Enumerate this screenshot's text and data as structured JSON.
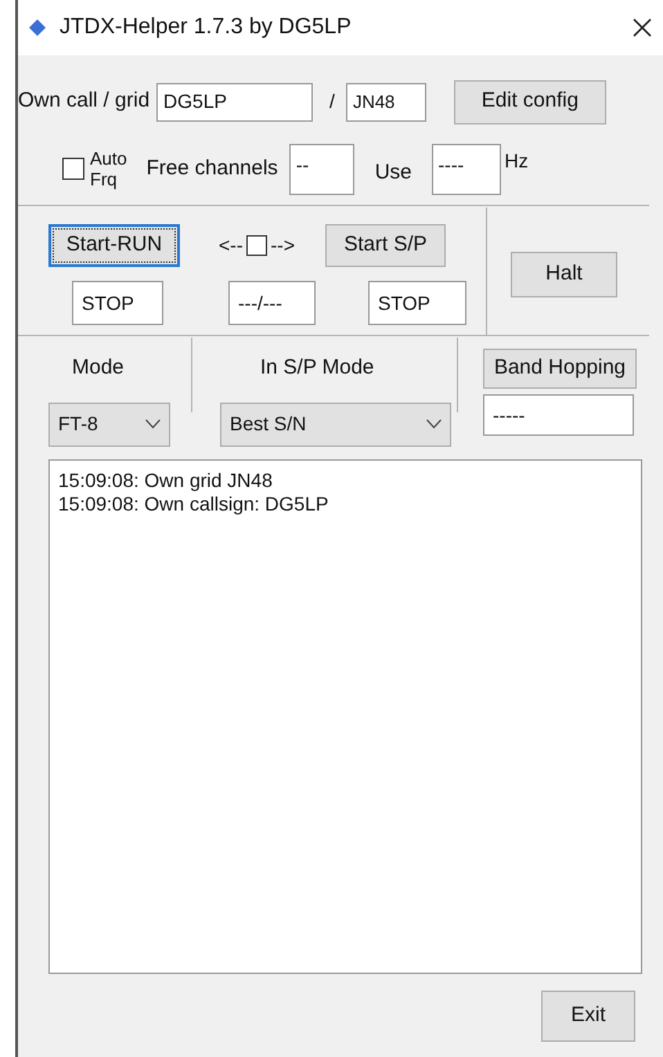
{
  "window": {
    "title": "JTDX-Helper 1.7.3 by DG5LP"
  },
  "own_call": {
    "label": "Own call / grid",
    "call": "DG5LP",
    "separator": "/",
    "grid": "JN48"
  },
  "edit_config_button": "Edit config",
  "auto_frq": {
    "label_lines": [
      "Auto",
      "Frq"
    ],
    "checked": false
  },
  "free_channels": {
    "label": "Free channels",
    "value": "--"
  },
  "use": {
    "label": "Use",
    "value": "----",
    "unit": "Hz"
  },
  "run": {
    "button": "Start-RUN",
    "focused": true,
    "status": "STOP"
  },
  "direction": {
    "left": "<--",
    "right": "-->",
    "checked": false,
    "value": "---/---"
  },
  "sp": {
    "button": "Start S/P",
    "focused": false,
    "status": "STOP"
  },
  "halt_button": "Halt",
  "mode": {
    "label": "Mode",
    "value": "FT-8"
  },
  "sp_mode": {
    "label": "In S/P Mode",
    "value": "Best S/N"
  },
  "band_hopping": {
    "button": "Band Hopping",
    "value": "-----"
  },
  "log": [
    "15:09:08: Own grid JN48",
    "15:09:08: Own callsign: DG5LP"
  ],
  "exit_button": "Exit"
}
